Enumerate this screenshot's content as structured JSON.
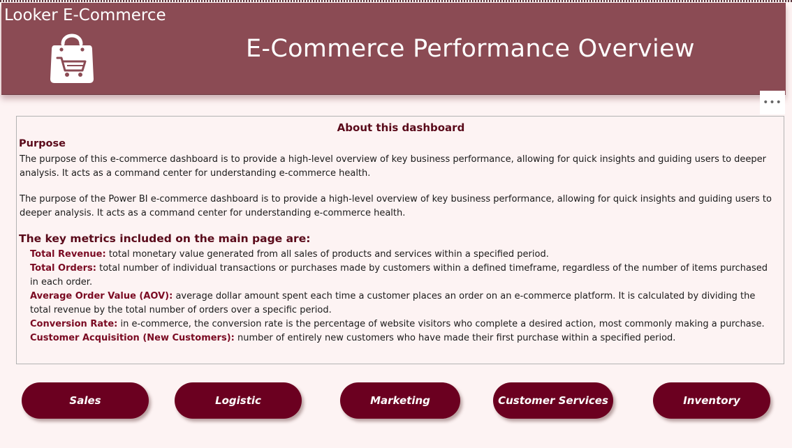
{
  "header": {
    "app_name": "Looker E-Commerce",
    "title": "E-Commerce Performance Overview",
    "logo_icon": "shopping-bag-cart-icon",
    "background_color": "#8b4b54"
  },
  "more_options": {
    "label": "•••",
    "icon": "more-options-icon"
  },
  "about": {
    "title": "About this dashboard",
    "purpose_heading": "Purpose",
    "paragraph_1": "The purpose of this e-commerce dashboard is to provide a high-level overview of key business performance, allowing for quick insights and guiding users to deeper analysis. It acts as a command center for understanding e-commerce health.",
    "paragraph_2": "The purpose of the Power BI e-commerce dashboard is to provide a high-level overview of key business performance, allowing for quick insights and guiding users to deeper analysis. It acts as a command center for understanding e-commerce health.",
    "metrics_heading": "The key metrics included on the main page are:",
    "metrics": [
      {
        "name": "Total Revenue:",
        "description": "total monetary value generated from all sales of products and services within a specified period."
      },
      {
        "name": "Total Orders:",
        "description": "total number of individual transactions or purchases made by customers within a defined timeframe, regardless of the number of items purchased in each order."
      },
      {
        "name": "Average Order Value (AOV):",
        "description": "average dollar amount spent each time a customer places an order on an e-commerce platform. It is calculated by dividing the total revenue by the total number of orders over a specific period."
      },
      {
        "name": "Conversion Rate:",
        "description": "in e-commerce, the conversion rate is the percentage of website visitors who complete a desired action, most commonly making a purchase."
      },
      {
        "name": "Customer Acquisition (New Customers):",
        "description": "number of entirely new customers who have made their first purchase within a specified period."
      }
    ]
  },
  "navigation": {
    "button_color": "#6b0020",
    "buttons": [
      {
        "label": "Sales"
      },
      {
        "label": "Logistic"
      },
      {
        "label": "Marketing"
      },
      {
        "label": "Customer Services"
      },
      {
        "label": "Inventory"
      }
    ]
  }
}
